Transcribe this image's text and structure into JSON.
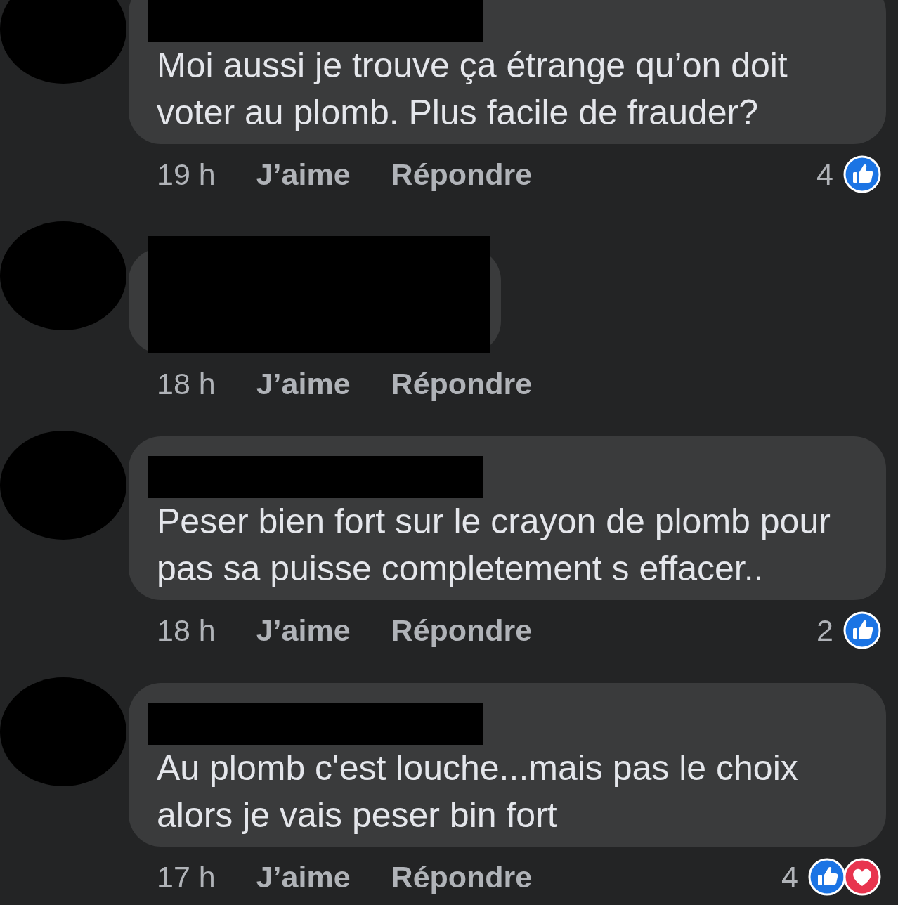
{
  "comments": [
    {
      "author_redacted": true,
      "text": "Moi aussi je trouve ça étrange qu’on doit voter au plomb. Plus facile de frauder?",
      "time": "19 h",
      "like_label": "J’aime",
      "reply_label": "Répondre",
      "reaction_count": "4",
      "reactions": [
        {
          "kind": "like"
        }
      ]
    },
    {
      "author_redacted": true,
      "time": "18 h",
      "like_label": "J’aime",
      "reply_label": "Répondre"
    },
    {
      "author_redacted": true,
      "text": "Peser bien fort sur le crayon de plomb pour pas sa puisse completement s effacer..",
      "time": "18 h",
      "like_label": "J’aime",
      "reply_label": "Répondre",
      "reaction_count": "2",
      "reactions": [
        {
          "kind": "like"
        }
      ]
    },
    {
      "author_redacted": true,
      "text": "Au plomb c'est louche...mais pas le choix alors je vais peser bin fort",
      "time": "17 h",
      "like_label": "J’aime",
      "reply_label": "Répondre",
      "reaction_count": "4",
      "reactions": [
        {
          "kind": "like"
        },
        {
          "kind": "love"
        }
      ]
    }
  ]
}
